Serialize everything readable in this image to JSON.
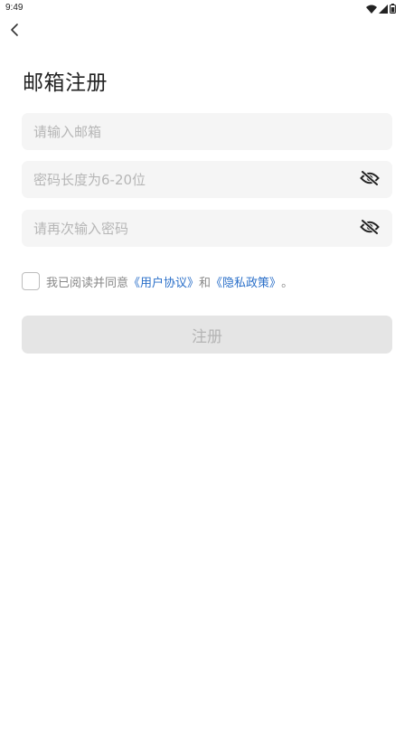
{
  "status_bar": {
    "time": "9:49",
    "icons": [
      "wifi-icon",
      "signal-icon",
      "battery-icon"
    ]
  },
  "header": {
    "back_icon": "chevron-left-icon"
  },
  "title": "邮箱注册",
  "form": {
    "email": {
      "placeholder": "请输入邮箱",
      "value": ""
    },
    "password": {
      "placeholder": "密码长度为6-20位",
      "value": "",
      "toggle_icon": "eye-off-icon"
    },
    "confirm_password": {
      "placeholder": "请再次输入密码",
      "value": "",
      "toggle_icon": "eye-off-icon"
    }
  },
  "agreement": {
    "checked": false,
    "prefix": "我已阅读并同意",
    "user_agreement": "《用户协议》",
    "conjunction": "和",
    "privacy_policy": "《隐私政策》",
    "suffix": "。"
  },
  "register_button": {
    "label": "注册"
  },
  "colors": {
    "link": "#2a6fc9",
    "field_bg": "#f5f5f5",
    "button_disabled_bg": "#e5e5e5",
    "button_disabled_text": "#b4b4b4",
    "placeholder": "#b6b6b6"
  }
}
